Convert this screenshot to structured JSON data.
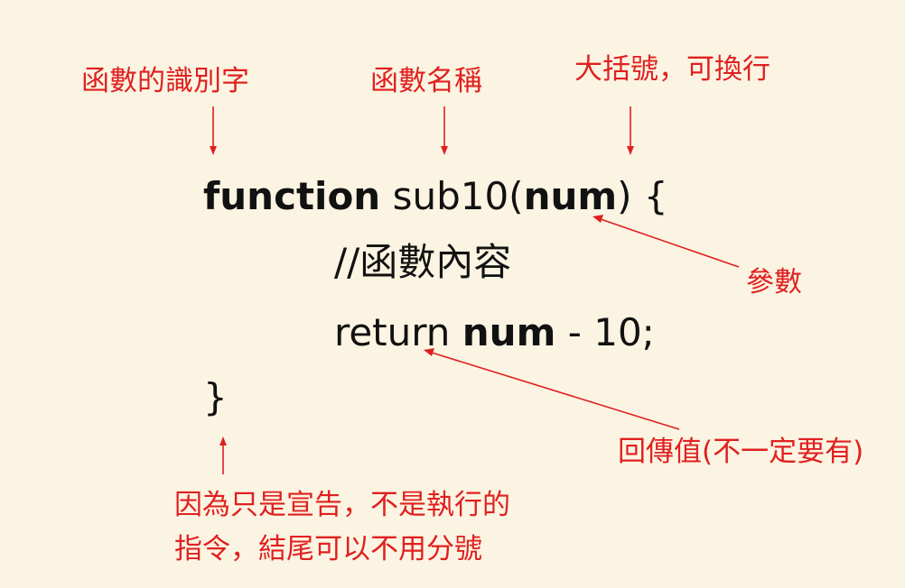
{
  "annotations": {
    "keyword_label": "函數的識別字",
    "name_label": "函數名稱",
    "brace_label": "大括號，可換行",
    "param_label": "參數",
    "return_label": "回傳值(不一定要有)",
    "declaration_note_line1": "因為只是宣告，不是執行的",
    "declaration_note_line2": "指令，結尾可以不用分號"
  },
  "code": {
    "keyword": "function",
    "func_name": "sub10(",
    "param": "num",
    "open_tail": ") {",
    "comment": "//函數內容",
    "return_kw": "return ",
    "return_var": "num",
    "return_tail": " - 10;",
    "close_brace": "}"
  },
  "colors": {
    "annotation": "#e02020",
    "code": "#111111",
    "background": "#fbf4e2"
  }
}
